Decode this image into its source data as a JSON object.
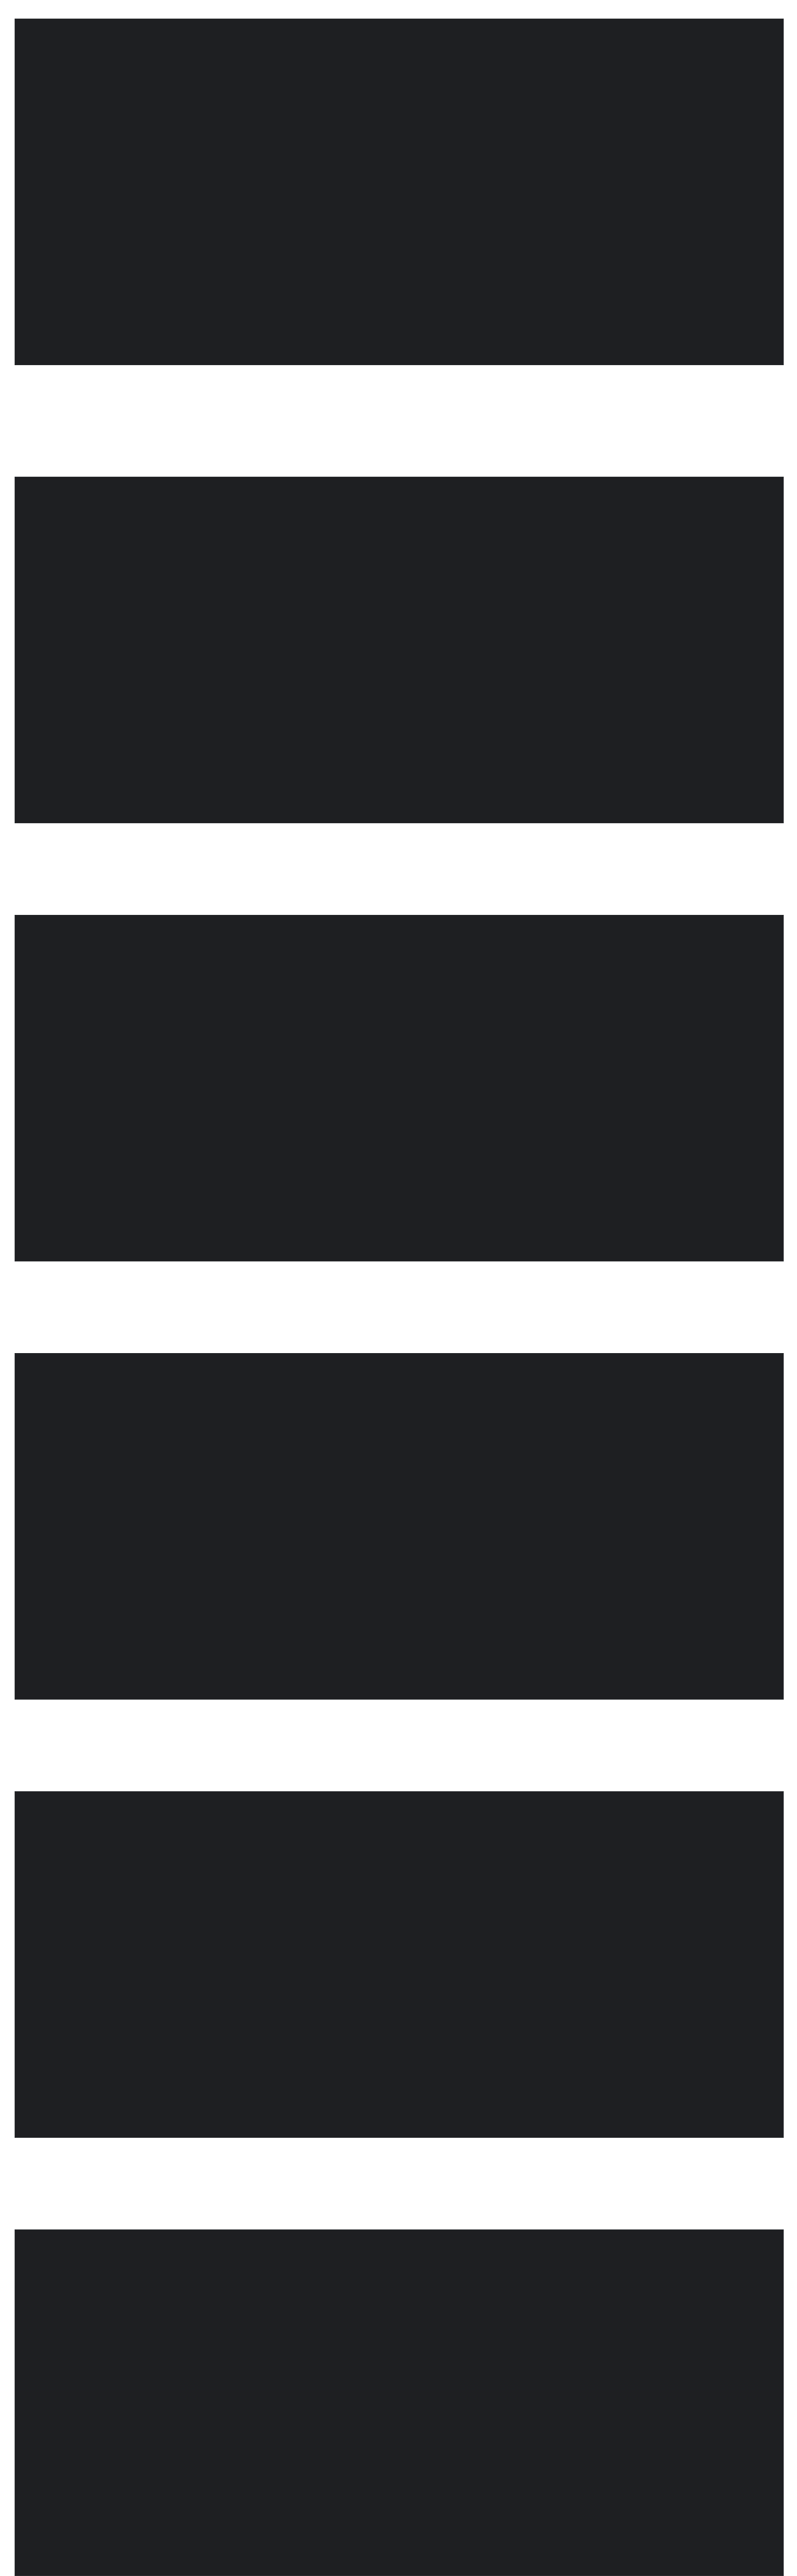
{
  "screenshot": {
    "note": ""
  }
}
